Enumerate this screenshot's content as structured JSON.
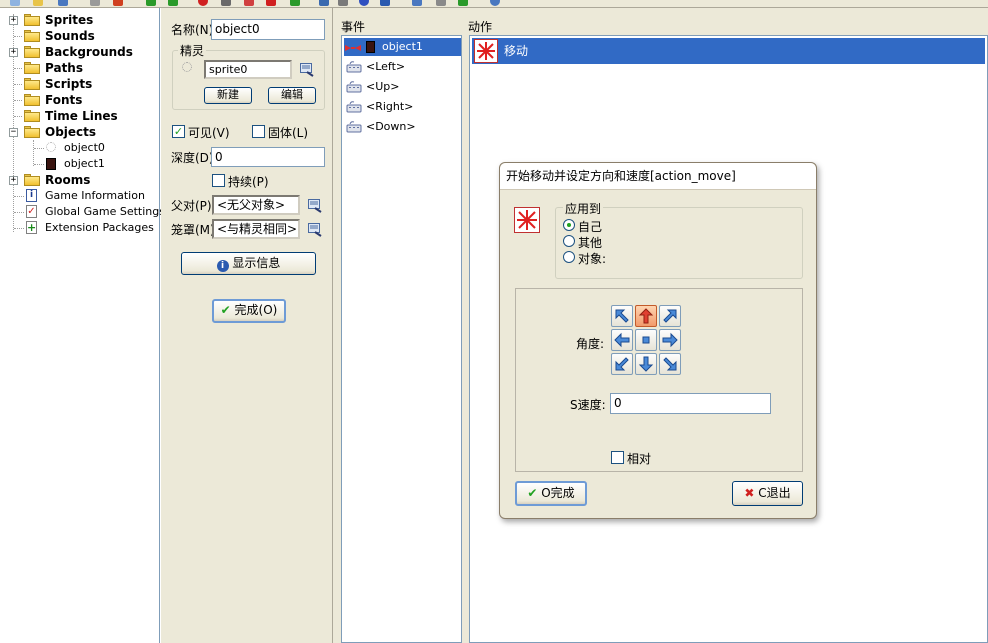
{
  "tree": {
    "items": [
      {
        "label": "Sprites"
      },
      {
        "label": "Sounds"
      },
      {
        "label": "Backgrounds"
      },
      {
        "label": "Paths"
      },
      {
        "label": "Scripts"
      },
      {
        "label": "Fonts"
      },
      {
        "label": "Time Lines"
      },
      {
        "label": "Objects"
      },
      {
        "label": "object0"
      },
      {
        "label": "object1"
      },
      {
        "label": "Rooms"
      },
      {
        "label": "Game Information"
      },
      {
        "label": "Global Game Settings"
      },
      {
        "label": "Extension Packages"
      }
    ]
  },
  "object": {
    "name_label": "名称(N)",
    "name_value": "object0",
    "sprite_group": "精灵",
    "sprite_value": "sprite0",
    "new_button": "新建",
    "edit_button": "编辑",
    "visible_label": "可见(V)",
    "solid_label": "固体(L)",
    "depth_label": "深度(D)",
    "depth_value": "0",
    "persistent_label": "持续(P)",
    "parent_label": "父对(P)",
    "parent_value": "<无父对象>",
    "mask_label": "笼罩(M)",
    "mask_value": "<与精灵相同>",
    "show_info_button": "显示信息",
    "ok_button": "完成(O)"
  },
  "events": {
    "header": "事件",
    "items": [
      {
        "label": "object1"
      },
      {
        "label": "<Left>"
      },
      {
        "label": "<Up>"
      },
      {
        "label": "<Right>"
      },
      {
        "label": "<Down>"
      }
    ]
  },
  "actions": {
    "header": "动作",
    "items": [
      {
        "label": "移动"
      }
    ]
  },
  "dialog": {
    "title": "开始移动并设定方向和速度[action_move]",
    "applies_to": "应用到",
    "opt_self": "自己",
    "opt_other": "其他",
    "opt_object": "对象:",
    "direction_label": "角度:",
    "speed_label": "S速度:",
    "speed_value": "0",
    "relative_label": "相对",
    "ok_button": "O完成",
    "cancel_button": "C退出"
  },
  "colors": {
    "selection": "#316ac5",
    "panel": "#ece9d8",
    "arrow_active": "#f29a6b"
  }
}
